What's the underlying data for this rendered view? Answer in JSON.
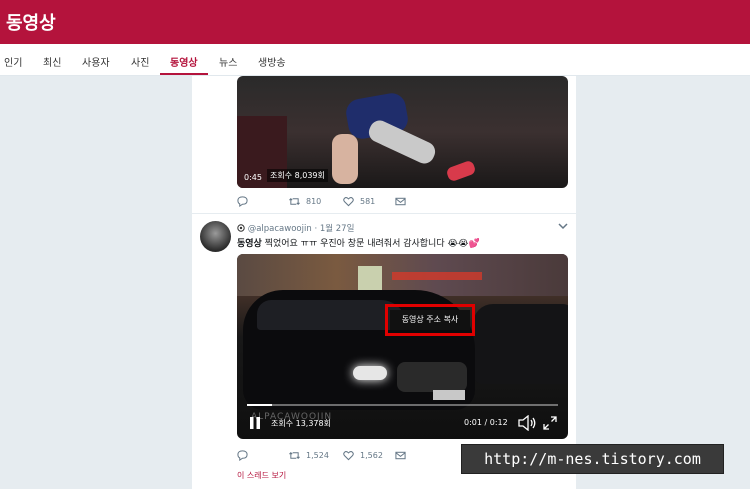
{
  "header": {
    "title": "동영상"
  },
  "tabs": [
    {
      "label": "인기"
    },
    {
      "label": "최신"
    },
    {
      "label": "사용자"
    },
    {
      "label": "사진"
    },
    {
      "label": "동영상"
    },
    {
      "label": "뉴스"
    },
    {
      "label": "생방송"
    }
  ],
  "active_tab": "동영상",
  "tweet1": {
    "video_time": "0:45",
    "video_views": "조회수 8,039회",
    "retweets": "810",
    "likes": "581"
  },
  "tweet2": {
    "handle": "@alpacawoojin",
    "date": "1월 27일",
    "meta_sep": "·",
    "text_bold": "동영상",
    "text": " 찍었어요 ㅠㅠ 우진아 창문 내려줘서 감사합니다 😭😭💕",
    "video_views": "조회수 13,378회",
    "video_time": "0:01 / 0:12",
    "video_progress": 0.08,
    "watermark": "ALPACAWOOJIN",
    "copy_menu": "동영상 주소 복사",
    "retweets": "1,524",
    "likes": "1,562",
    "thread_link": "이 스레드 보기"
  },
  "overlay_url": "http://m-nes.tistory.com",
  "colors": {
    "brand": "#b4133c",
    "background": "#e6ecf0"
  }
}
